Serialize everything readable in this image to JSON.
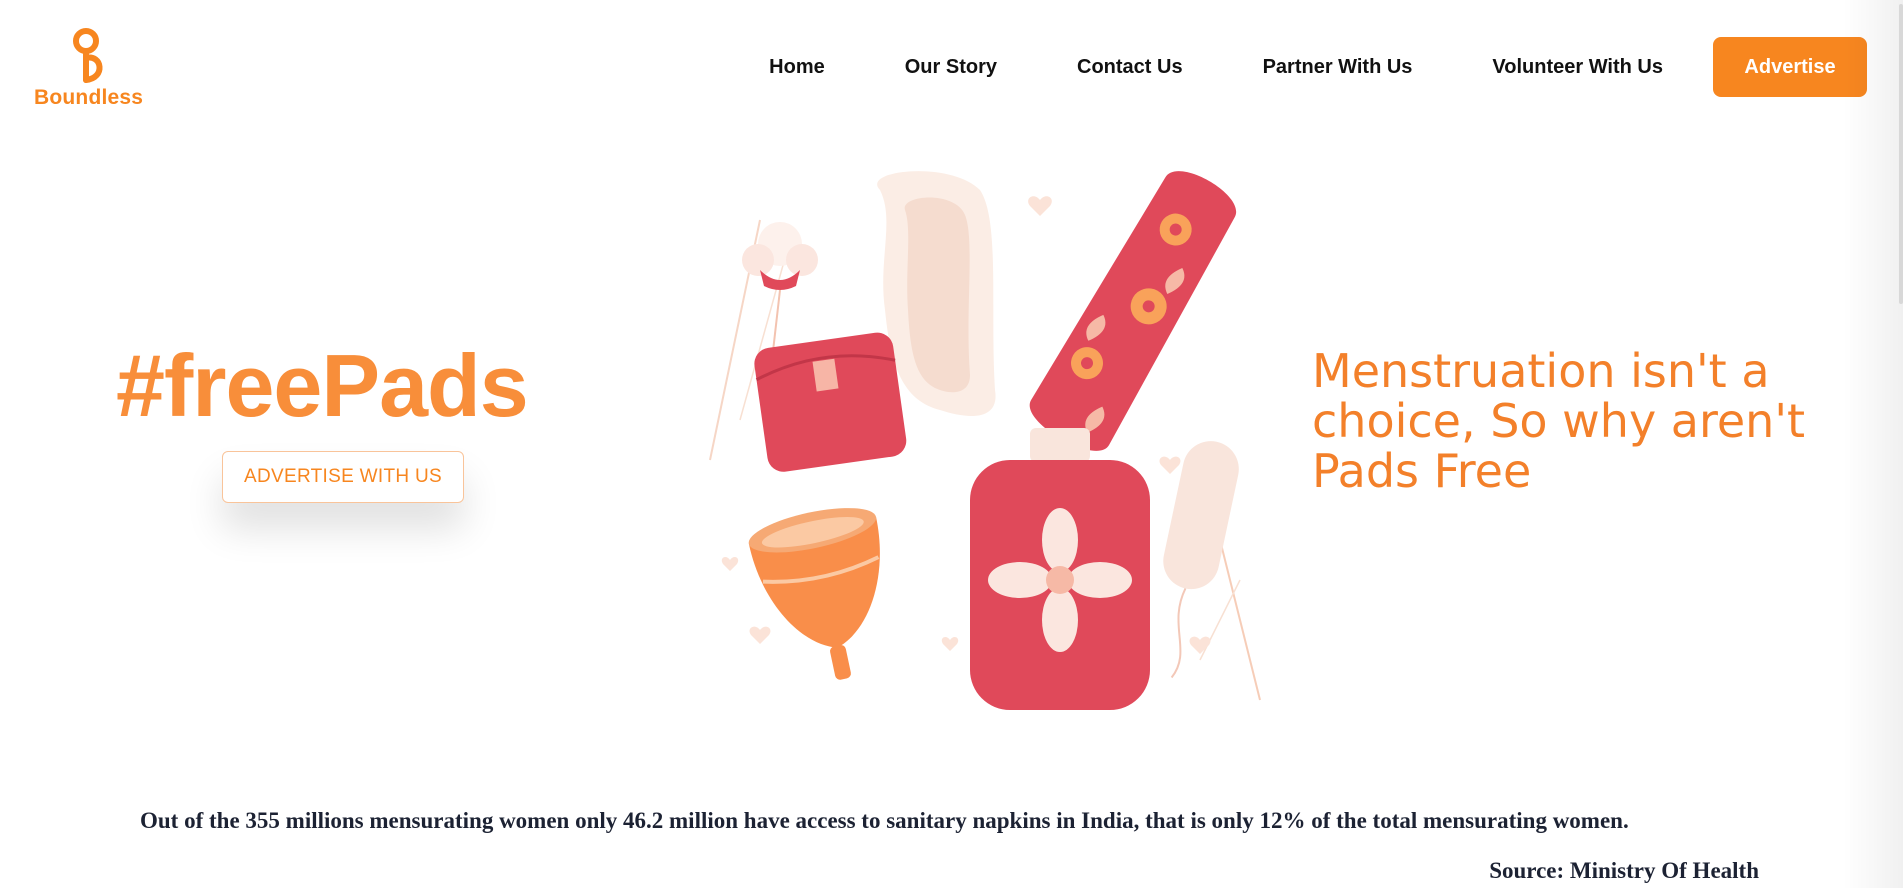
{
  "brand": {
    "name": "Boundless",
    "color": "#f7861f"
  },
  "nav": {
    "items": [
      {
        "label": "Home"
      },
      {
        "label": "Our Story"
      },
      {
        "label": "Contact Us"
      },
      {
        "label": "Partner With Us"
      },
      {
        "label": "Volunteer With Us"
      }
    ],
    "cta_label": "Advertise"
  },
  "hero": {
    "hashtag": "#freePads",
    "cta_label": "ADVERTISE WITH US",
    "illustration_icon": "menstrual-products-illustration",
    "tagline": "Menstruation isn't a choice, So why aren't Pads Free"
  },
  "stat": {
    "text": "Out of the 355 millions mensurating women only 46.2 million have access to sanitary napkins in India, that is only 12% of the total mensurating women.",
    "source": "Source: Ministry Of Health"
  },
  "colors": {
    "accent": "#f7861f",
    "accent_light": "#f88e3a",
    "product_red": "#e0495a",
    "product_orange": "#f98e4a",
    "pad_cream": "#fbece4"
  }
}
